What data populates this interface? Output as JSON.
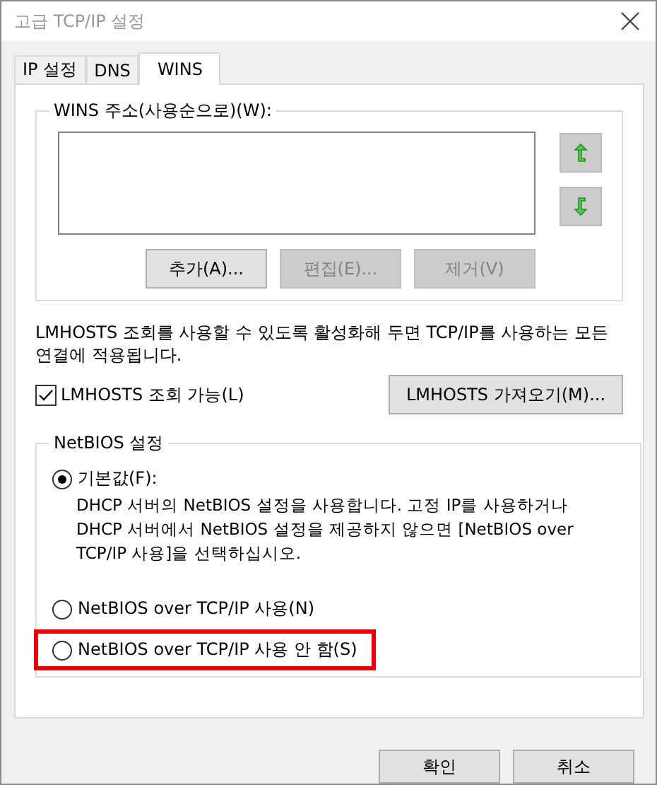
{
  "window": {
    "title": "고급 TCP/IP 설정"
  },
  "tabs": [
    {
      "label": "IP 설정",
      "selected": false
    },
    {
      "label": "DNS",
      "selected": false
    },
    {
      "label": "WINS",
      "selected": true
    }
  ],
  "wins_group": {
    "title": "WINS 주소(사용순으로)(W):",
    "buttons": [
      {
        "label": "추가(A)...",
        "disabled": false
      },
      {
        "label": "편집(E)...",
        "disabled": true
      },
      {
        "label": "제거(V)",
        "disabled": true
      }
    ]
  },
  "lmhosts": {
    "description": "LMHOSTS 조회를 사용할 수 있도록 활성화해 두면 TCP/IP를 사용하는 모든 연결에 적용됩니다.",
    "checkbox": {
      "label": "LMHOSTS 조회 가능(L)",
      "checked": true
    },
    "import_button": "LMHOSTS 가져오기(M)..."
  },
  "netbios_group": {
    "title": "NetBIOS 설정",
    "options": [
      {
        "label": "기본값(F):",
        "selected": true,
        "highlighted": false,
        "description": "DHCP 서버의 NetBIOS 설정을 사용합니다. 고정 IP를 사용하거나 DHCP 서버에서 NetBIOS 설정을 제공하지 않으면 [NetBIOS over TCP/IP 사용]을 선택하십시오."
      },
      {
        "label": "NetBIOS over TCP/IP 사용(N)",
        "selected": false,
        "highlighted": false
      },
      {
        "label": "NetBIOS over TCP/IP 사용 안 함(S)",
        "selected": false,
        "highlighted": true
      }
    ]
  },
  "buttons": [
    "확인",
    "취소"
  ]
}
